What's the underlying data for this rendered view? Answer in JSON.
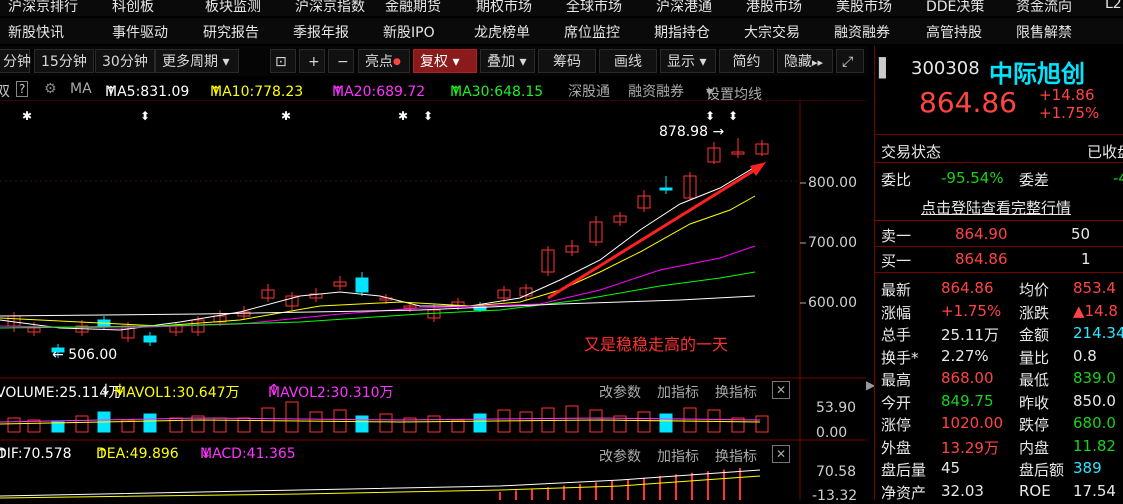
{
  "menu_top": [
    "沪深京排行",
    "科创板",
    "板块监测",
    "沪深京指数",
    "金融期货",
    "期权市场",
    "全球市场",
    "沪深港通",
    "港股市场",
    "美股市场",
    "DDE决策",
    "资金流向",
    "L2"
  ],
  "menu_main": [
    "新股快讯",
    "事件驱动",
    "研究报告",
    "季报年报",
    "新股IPO",
    "龙虎榜单",
    "席位监控",
    "期指持仓",
    "大宗交易",
    "融资融券",
    "高管持股",
    "限售解禁"
  ],
  "toolbar": {
    "periods": [
      "分钟",
      "15分钟",
      "30分钟",
      "更多周期"
    ],
    "plus": "+",
    "minus": "−",
    "highlight": "亮点",
    "fuquan": "复权",
    "overlay": "叠加",
    "chips": "筹码",
    "draw": "画线",
    "display": "显示",
    "simple": "简约",
    "hide": "隐藏"
  },
  "ma_line": {
    "ma_prefix": "双",
    "q": "?",
    "ma_label": "MA",
    "ma5": "MA5:831.09",
    "ma10": "MA10:778.23",
    "ma20": "MA20:689.72",
    "ma30": "MA30:648.15",
    "sgt": "深股通",
    "margin": "融资融券",
    "setting": "设置均线"
  },
  "price_axis": [
    "800.00",
    "700.00",
    "600.00"
  ],
  "annotations": {
    "high_label": "878.98",
    "low_label": "506.00",
    "note": "又是稳稳走高的一天"
  },
  "vol_header": {
    "vol": "VOLUME:25.114万",
    "mavol1": "MAVOL1:30.647万",
    "mavol2": "MAVOL2:30.310万",
    "change_param": "改参数",
    "add_ind": "加指标",
    "switch_ind": "换指标"
  },
  "vol_axis": [
    "53.90",
    "0.00"
  ],
  "macd_header": {
    "dif": "DIF:70.578",
    "dea": "DEA:49.896",
    "macd": "MACD:41.365",
    "change_param": "改参数",
    "add_ind": "加指标",
    "switch_ind": "换指标"
  },
  "macd_axis": [
    "70.58",
    "-13.32"
  ],
  "stock": {
    "code": "300308",
    "name": "中际旭创",
    "price": "864.86",
    "change": "+14.86",
    "pct": "+1.75%"
  },
  "quote": {
    "status_label": "交易状态",
    "status_value": "已收盘",
    "weibi_label": "委比",
    "weibi_value": "-95.54%",
    "weicha_label": "委差",
    "weicha_value": "-4",
    "login_link": "点击登陆查看完整行情",
    "sell1_label": "卖一",
    "sell1_price": "864.90",
    "sell1_vol": "50",
    "buy1_label": "买一",
    "buy1_price": "864.86",
    "buy1_vol": "1"
  },
  "stats": [
    {
      "l1": "最新",
      "v1": "864.86",
      "c1": "red",
      "l2": "均价",
      "v2": "853.4",
      "c2": "red"
    },
    {
      "l1": "涨幅",
      "v1": "+1.75%",
      "c1": "red",
      "l2": "涨跌",
      "v2": "▲14.8",
      "c2": "red"
    },
    {
      "l1": "总手",
      "v1": "25.11万",
      "c1": "white",
      "l2": "金额",
      "v2": "214.34",
      "c2": "cyan"
    },
    {
      "l1": "换手*",
      "v1": "2.27%",
      "c1": "white",
      "l2": "量比",
      "v2": "0.8",
      "c2": "white"
    },
    {
      "l1": "最高",
      "v1": "868.00",
      "c1": "red",
      "l2": "最低",
      "v2": "839.0",
      "c2": "green"
    },
    {
      "l1": "今开",
      "v1": "849.75",
      "c1": "green",
      "l2": "昨收",
      "v2": "850.0",
      "c2": "white"
    },
    {
      "l1": "涨停",
      "v1": "1020.00",
      "c1": "red",
      "l2": "跌停",
      "v2": "680.0",
      "c2": "green"
    },
    {
      "l1": "外盘",
      "v1": "13.29万",
      "c1": "red",
      "l2": "内盘",
      "v2": "11.82",
      "c2": "green"
    },
    {
      "l1": "盘后量",
      "v1": "45",
      "c1": "white",
      "l2": "盘后额",
      "v2": "389",
      "c2": "cyan"
    },
    {
      "l1": "净资产",
      "v1": "32.03",
      "c1": "white",
      "l2": "ROE",
      "v2": "17.54",
      "c2": "white"
    }
  ],
  "colors": {
    "up": "#ff3333",
    "down": "#00e5ff",
    "ma5": "#ffffff",
    "ma10": "#ffff00",
    "ma20": "#ff00ff",
    "ma30": "#00ff00",
    "grid": "#7a0000"
  }
}
